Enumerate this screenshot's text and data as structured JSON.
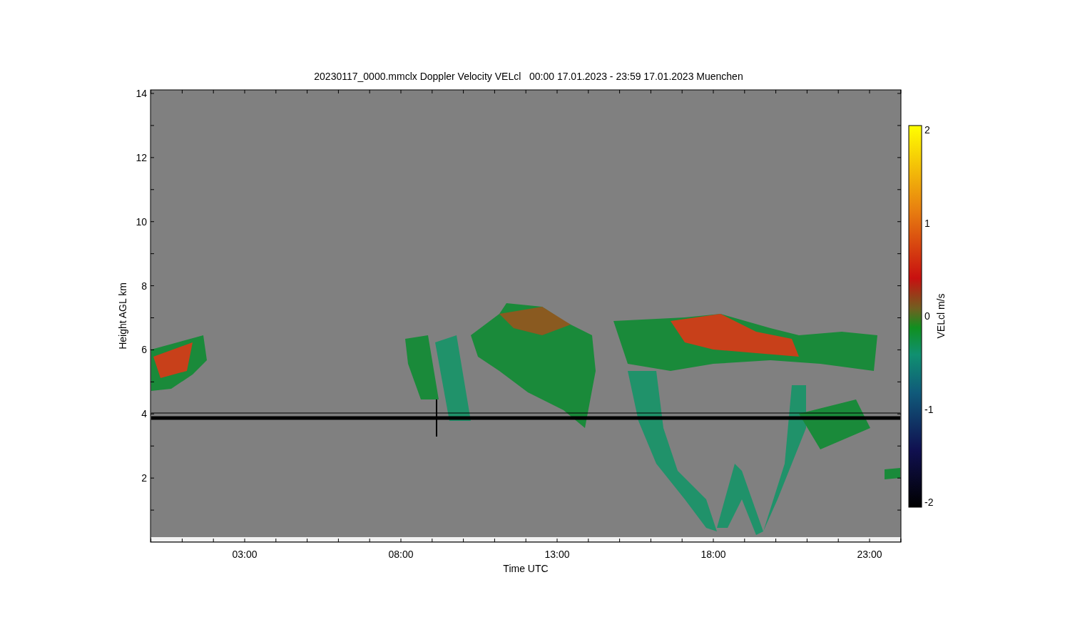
{
  "title": "20230117_0000.mmclx Doppler Velocity VELcl   00:00 17.01.2023 - 23:59 17.01.2023 Muenchen",
  "y_axis": {
    "label": "Height AGL km",
    "ticks": [
      "14",
      "12",
      "10",
      "8",
      "6",
      "4",
      "2"
    ]
  },
  "x_axis": {
    "label": "Time UTC",
    "ticks": [
      "03:00",
      "08:00",
      "13:00",
      "18:00",
      "23:00"
    ]
  },
  "colorbar": {
    "label": "VELcl m/s",
    "ticks": [
      "2",
      "1",
      "0",
      "-1",
      "-2"
    ]
  }
}
